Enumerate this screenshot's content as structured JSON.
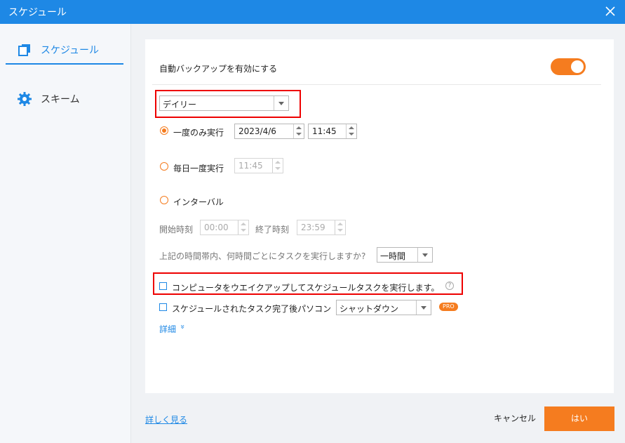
{
  "window": {
    "title": "スケジュール"
  },
  "sidebar": {
    "items": [
      {
        "label": "スケジュール",
        "icon": "copy-icon",
        "active": true
      },
      {
        "label": "スキーム",
        "icon": "gear-icon",
        "active": false
      }
    ]
  },
  "main": {
    "auto_backup_label": "自動バックアップを有効にする",
    "frequency_value": "デイリー",
    "once": {
      "label": "一度のみ実行",
      "date": "2023/4/6",
      "time": "11:45"
    },
    "daily": {
      "label": "毎日一度実行",
      "time": "11:45"
    },
    "interval": {
      "label": "インターバル",
      "start_label": "開始時刻",
      "start_value": "00:00",
      "end_label": "終了時刻",
      "end_value": "23:59",
      "repeat_question": "上記の時間帯内、何時間ごとにタスクを実行しますか?",
      "repeat_value": "一時間"
    },
    "wake_label": "コンピュータをウエイクアップしてスケジュールタスクを実行します。",
    "help_symbol": "?",
    "after_task_label": "スケジュールされたタスク完了後パソコン",
    "after_task_value": "シャットダウン",
    "pro_badge": "PRO",
    "details_label": "詳細",
    "details_chevron": "»"
  },
  "footer": {
    "learn_more": "詳しく見る",
    "cancel": "キャンセル",
    "ok": "はい"
  },
  "colors": {
    "accent": "#1e88e5",
    "orange": "#f57c1f",
    "highlight": "#e00000"
  }
}
